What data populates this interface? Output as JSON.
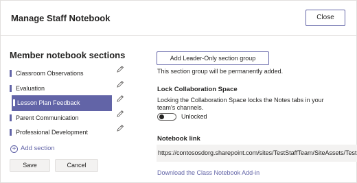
{
  "dialog": {
    "title": "Manage Staff Notebook",
    "close_label": "Close"
  },
  "sections": {
    "heading": "Member notebook sections",
    "items": [
      {
        "label": "Classroom Observations",
        "selected": false
      },
      {
        "label": "Evaluation",
        "selected": false
      },
      {
        "label": "Lesson Plan Feedback",
        "selected": true
      },
      {
        "label": "Parent Communication",
        "selected": false
      },
      {
        "label": "Professional Development",
        "selected": false
      }
    ],
    "add_label": "Add section",
    "save_label": "Save",
    "cancel_label": "Cancel"
  },
  "leader": {
    "button_label": "Add Leader-Only section group",
    "note": "This section group will be permanently added."
  },
  "lock": {
    "heading": "Lock Collaboration Space",
    "description": "Locking the Collaboration Space locks the Notes tabs in your team's channels.",
    "toggle_state": "Unlocked"
  },
  "notebook_link": {
    "heading": "Notebook link",
    "url": "https://contososdorg.sharepoint.com/sites/TestStaffTeam/SiteAssets/Test",
    "download_label": "Download the Class Notebook Add-in"
  },
  "colors": {
    "accent": "#6264a7",
    "text": "#252423",
    "field_bg": "#f3f2f1"
  }
}
